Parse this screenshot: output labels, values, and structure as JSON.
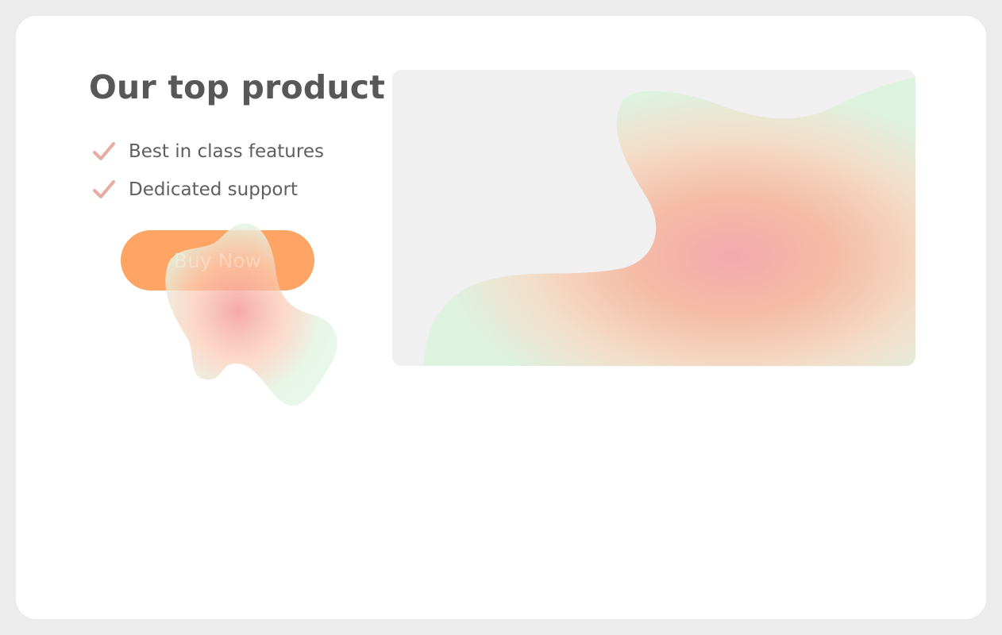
{
  "product": {
    "title": "Our top product",
    "features": [
      {
        "label": "Best in class features",
        "icon": "check-icon"
      },
      {
        "label": "Dedicated support",
        "icon": "check-icon"
      }
    ],
    "cta": {
      "label": "Buy Now"
    }
  },
  "colors": {
    "background": "#ececec",
    "card": "#ffffff",
    "title": "#58585a",
    "text": "#5f5f61",
    "check": "#e8ab9f",
    "button": "#fea465",
    "button_text": "#fde9d2",
    "image_placeholder": "#f0f0f0"
  }
}
